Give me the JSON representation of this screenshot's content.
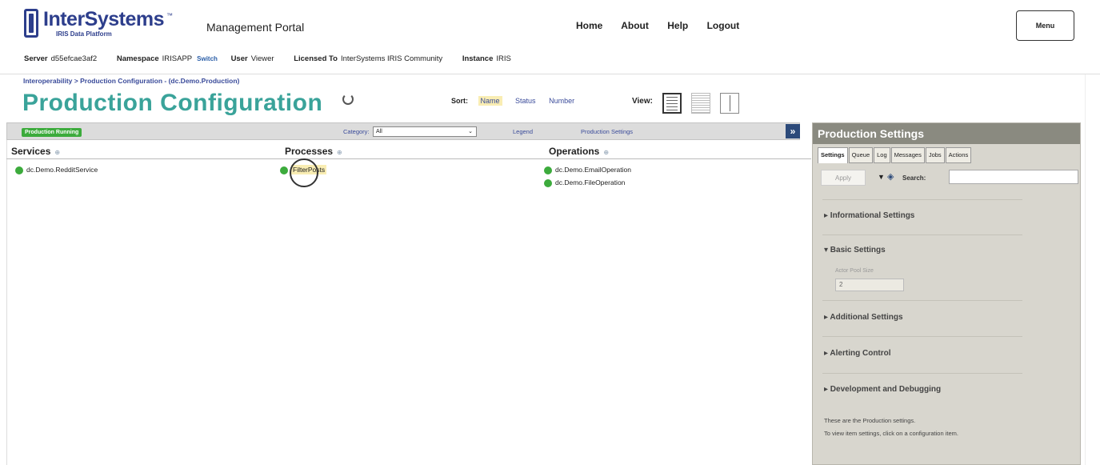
{
  "header": {
    "logo_name": "InterSystems",
    "logo_tm": "™",
    "logo_sub": "IRIS Data Platform",
    "portal_title": "Management Portal",
    "nav": [
      "Home",
      "About",
      "Help",
      "Logout"
    ],
    "menu_label": "Menu",
    "info": {
      "server_label": "Server",
      "server_value": "d55efcae3af2",
      "namespace_label": "Namespace",
      "namespace_value": "IRISAPP",
      "switch_label": "Switch",
      "user_label": "User",
      "user_value": "Viewer",
      "licensed_label": "Licensed To",
      "licensed_value": "InterSystems IRIS Community",
      "instance_label": "Instance",
      "instance_value": "IRIS"
    }
  },
  "title_bar": {
    "breadcrumb": "Interoperability > Production Configuration - (dc.Demo.Production)",
    "page_title": "Production Configuration",
    "sort_label": "Sort:",
    "sort_options": [
      "Name",
      "Status",
      "Number"
    ],
    "sort_active": "Name",
    "view_label": "View:"
  },
  "toolbar": {
    "status_badge": "Production Running",
    "category_label": "Category:",
    "category_value": "All",
    "legend_link": "Legend",
    "settings_link": "Production Settings",
    "expand_icon": "»"
  },
  "columns": {
    "services": {
      "title": "Services",
      "items": [
        "dc.Demo.RedditService"
      ]
    },
    "processes": {
      "title": "Processes",
      "items": [
        "FilterPosts"
      ]
    },
    "operations": {
      "title": "Operations",
      "items": [
        "dc.Demo.EmailOperation",
        "dc.Demo.FileOperation"
      ]
    }
  },
  "status_color": "#3cab3c",
  "accent_color": "#3aa39a",
  "right_panel": {
    "title": "Production Settings",
    "tabs": [
      "Settings",
      "Queue",
      "Log",
      "Messages",
      "Jobs",
      "Actions"
    ],
    "active_tab": "Settings",
    "apply_label": "Apply",
    "search_label": "Search:",
    "sections": {
      "informational": "▸ Informational Settings",
      "basic": "▾ Basic Settings",
      "additional": "▸ Additional Settings",
      "alerting": "▸ Alerting Control",
      "dev": "▸ Development and Debugging"
    },
    "pool_label": "Actor Pool Size",
    "pool_value": "2",
    "note_line1": "These are the Production settings.",
    "note_line2": "To view item settings, click on a configuration item."
  }
}
